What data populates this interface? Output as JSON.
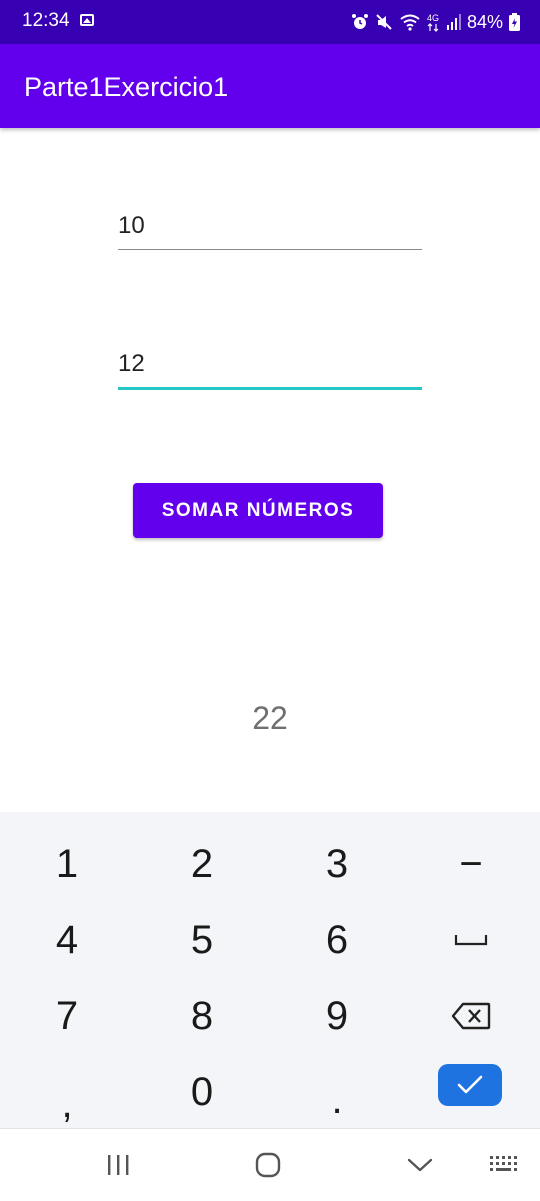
{
  "status_bar": {
    "time": "12:34",
    "battery": "84%",
    "icons": [
      "photo-icon",
      "alarm-icon",
      "mute-icon",
      "wifi-icon",
      "4g-icon",
      "signal-icon",
      "battery-charging-icon"
    ]
  },
  "app_bar": {
    "title": "Parte1Exercicio1"
  },
  "form": {
    "field1_value": "10",
    "field2_value": "12",
    "sum_button_label": "SOMAR NÚMEROS",
    "result": "22"
  },
  "keyboard": {
    "rows": [
      [
        "1",
        "2",
        "3",
        "−"
      ],
      [
        "4",
        "5",
        "6",
        "space"
      ],
      [
        "7",
        "8",
        "9",
        "backspace"
      ],
      [
        ",",
        "0",
        ".",
        "done"
      ]
    ],
    "k1": "1",
    "k2": "2",
    "k3": "3",
    "kminus": "−",
    "k4": "4",
    "k5": "5",
    "k6": "6",
    "k7": "7",
    "k8": "8",
    "k9": "9",
    "kcomma": ",",
    "k0": "0",
    "kdot": "."
  },
  "nav_bar": {
    "icons": [
      "recents-icon",
      "home-icon",
      "hide-keyboard-icon",
      "keyboard-switch-icon"
    ]
  },
  "colors": {
    "status_bar": "#3700b3",
    "primary": "#6200ee",
    "accent_underline": "#26c6c6",
    "done_key": "#1f73e0",
    "keyboard_bg": "#f4f5f8"
  }
}
